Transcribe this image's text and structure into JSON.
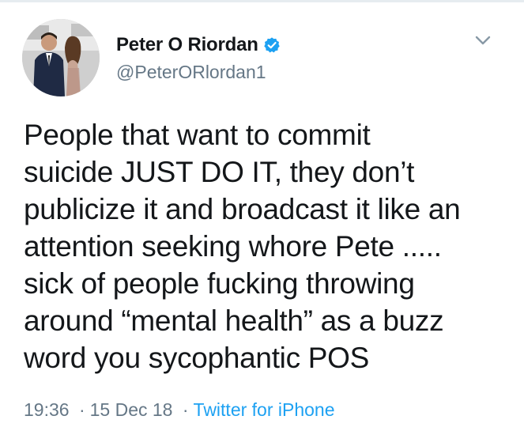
{
  "tweet": {
    "author": {
      "display_name": "Peter O Riordan",
      "handle": "@PeterORlordan1",
      "verified": true,
      "avatar_icon": "profile-photo"
    },
    "menu_icon": "chevron-down-icon",
    "text_lines": [
      "People that want to commit",
      "suicide JUST DO IT, they don’t",
      "publicize it and broadcast it like an",
      "attention seeking whore Pete .....",
      "sick of people fucking throwing",
      "around “mental health” as a buzz",
      "word you sycophantic POS"
    ],
    "time": "19:36",
    "separator": "·",
    "date": "15 Dec 18",
    "source": "Twitter for iPhone"
  },
  "colors": {
    "text": "#14171a",
    "secondary": "#657786",
    "link": "#1da1f2",
    "verified_badge": "#1da1f2",
    "divider": "#e6ecf0"
  }
}
